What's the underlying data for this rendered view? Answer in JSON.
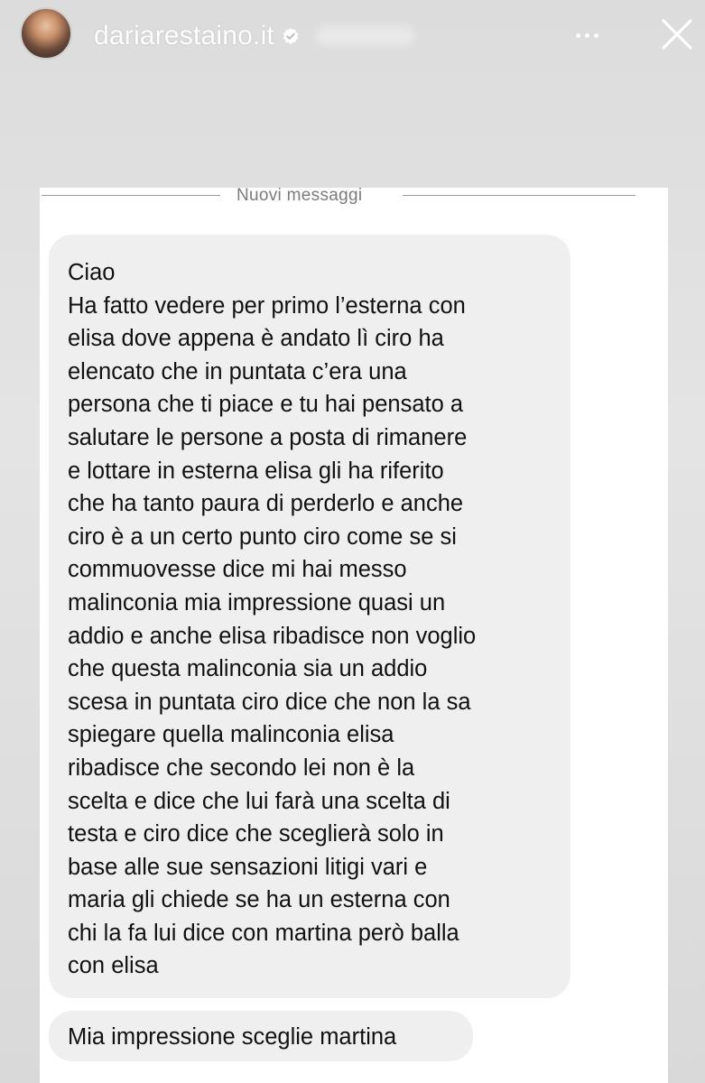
{
  "header": {
    "username": "dariarestaino.it",
    "verified_icon": "verified-badge-icon",
    "more_icon": "more-options-icon",
    "close_icon": "close-icon"
  },
  "chat": {
    "new_messages_label": "Nuovi messaggi",
    "message_1_lines": [
      "Ciao",
      "Ha fatto vedere per primo l’esterna  con",
      "elisa dove appena è andato lì ciro ha",
      "elencato che in puntata c’era una",
      "persona che ti piace e tu hai pensato a",
      "salutare le persone a posta di rimanere",
      "e lottare in esterna elisa gli ha riferito",
      "che ha tanto paura di perderlo e anche",
      "ciro è a un certo punto ciro come se si",
      "commuovesse dice mi hai messo",
      "malinconia mia impressione quasi un",
      "addio e anche elisa ribadisce non voglio",
      "che questa malinconia sia un addio",
      "scesa in puntata ciro dice che non la sa",
      "spiegare quella malinconia elisa",
      "ribadisce che secondo lei non è la",
      "scelta e dice che lui farà una scelta di",
      "testa e ciro dice che sceglierà solo in",
      "base alle sue sensazioni litigi vari e",
      "maria gli chiede se ha un esterna con",
      "chi la fa lui dice con martina però balla",
      "con elisa"
    ],
    "message_2": "Mia impressione sceglie martina"
  }
}
